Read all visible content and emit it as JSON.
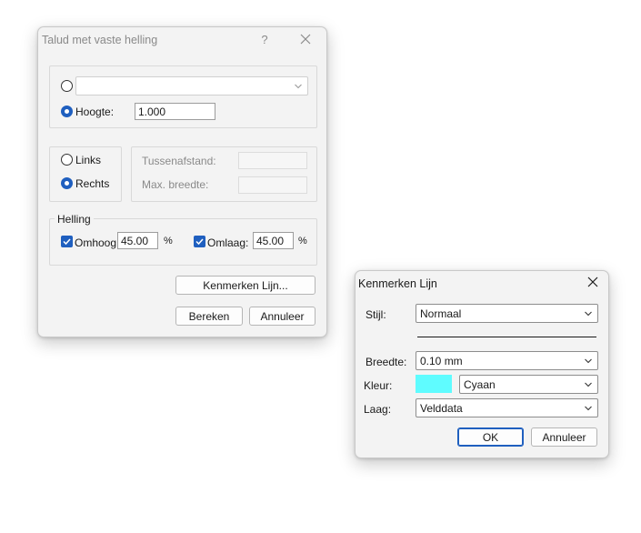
{
  "dialog1": {
    "title": "Talud met vaste helling",
    "help_glyph": "?",
    "close_glyph": "✕",
    "combo_value": "",
    "hoogte_label": "Hoogte:",
    "hoogte_value": "1.000",
    "links_label": "Links",
    "rechts_label": "Rechts",
    "tussenafstand_label": "Tussenafstand:",
    "tussenafstand_value": "",
    "max_breedte_label": "Max. breedte:",
    "max_breedte_value": "",
    "helling_label": "Helling",
    "omhoog_label": "Omhoog:",
    "omhoog_value": "45.00",
    "omhoog_unit": "%",
    "omlaag_label": "Omlaag:",
    "omlaag_value": "45.00",
    "omlaag_unit": "%",
    "kenmerken_button": "Kenmerken Lijn...",
    "bereken_button": "Bereken",
    "annuleer_button": "Annuleer"
  },
  "dialog2": {
    "title": "Kenmerken Lijn",
    "close_glyph": "✕",
    "stijl_label": "Stijl:",
    "stijl_value": "Normaal",
    "breedte_label": "Breedte:",
    "breedte_value": "0.10 mm",
    "kleur_label": "Kleur:",
    "kleur_value": "Cyaan",
    "kleur_swatch": "#5ffcff",
    "laag_label": "Laag:",
    "laag_value": "Velddata",
    "ok_button": "OK",
    "annuleer_button": "Annuleer"
  },
  "colors": {
    "accent": "#1f5fbf",
    "dialog_bg": "#f3f3f3"
  }
}
